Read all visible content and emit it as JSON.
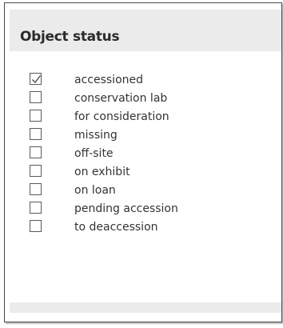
{
  "panel": {
    "title": "Object status",
    "items": [
      {
        "label": "accessioned",
        "checked": true
      },
      {
        "label": "conservation lab",
        "checked": false
      },
      {
        "label": "for consideration",
        "checked": false
      },
      {
        "label": "missing",
        "checked": false
      },
      {
        "label": "off-site",
        "checked": false
      },
      {
        "label": "on exhibit",
        "checked": false
      },
      {
        "label": "on loan",
        "checked": false
      },
      {
        "label": "pending accession",
        "checked": false
      },
      {
        "label": "to deaccession",
        "checked": false
      }
    ]
  },
  "colors": {
    "header_bg": "#ebebeb",
    "border": "#4a4a4a",
    "text": "#333333"
  }
}
